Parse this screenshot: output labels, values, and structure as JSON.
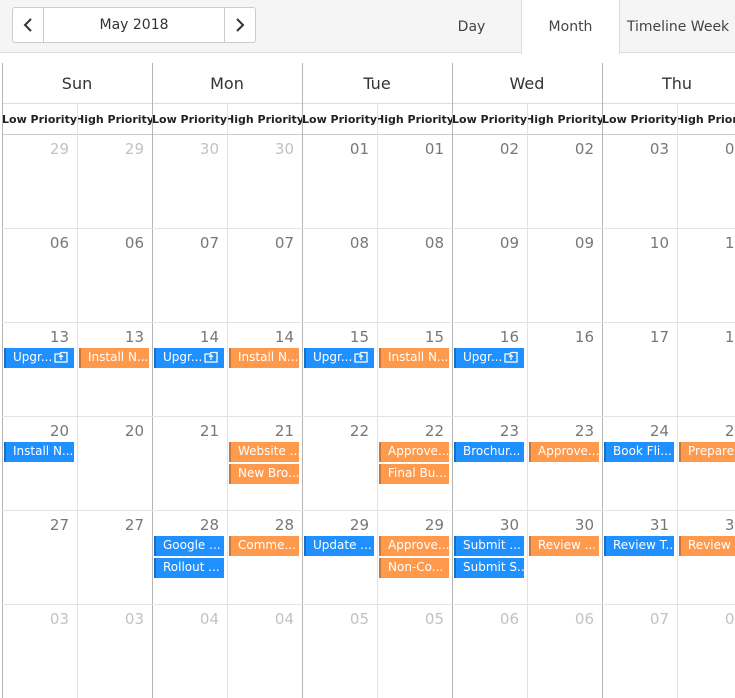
{
  "toolbar": {
    "period_title": "May 2018",
    "views": [
      "Day",
      "Month",
      "Timeline Week"
    ],
    "active_view": "Month"
  },
  "day_headers": [
    "Sun",
    "Mon",
    "Tue",
    "Wed",
    "Thu"
  ],
  "resource_headers": [
    "Low Priority",
    "High Priority"
  ],
  "weeks": [
    {
      "dates": [
        "29",
        "30",
        "01",
        "02",
        "03"
      ],
      "other_month": [
        true,
        true,
        false,
        false,
        false
      ]
    },
    {
      "dates": [
        "06",
        "07",
        "08",
        "09",
        "10"
      ],
      "other_month": [
        false,
        false,
        false,
        false,
        false
      ]
    },
    {
      "dates": [
        "13",
        "14",
        "15",
        "16",
        "17"
      ],
      "other_month": [
        false,
        false,
        false,
        false,
        false
      ]
    },
    {
      "dates": [
        "20",
        "21",
        "22",
        "23",
        "24"
      ],
      "other_month": [
        false,
        false,
        false,
        false,
        false
      ]
    },
    {
      "dates": [
        "27",
        "28",
        "29",
        "30",
        "31"
      ],
      "other_month": [
        false,
        false,
        false,
        false,
        false
      ]
    },
    {
      "dates": [
        "03",
        "04",
        "05",
        "06",
        "07"
      ],
      "other_month": [
        true,
        true,
        true,
        true,
        true
      ]
    }
  ],
  "appointments": [
    {
      "text": "Upgr...",
      "week": 2,
      "day": 0,
      "priority": "low",
      "slot": 0,
      "recurring": true
    },
    {
      "text": "Install N...",
      "week": 2,
      "day": 0,
      "priority": "high",
      "slot": 0
    },
    {
      "text": "Upgr...",
      "week": 2,
      "day": 1,
      "priority": "low",
      "slot": 0,
      "recurring": true
    },
    {
      "text": "Install N...",
      "week": 2,
      "day": 1,
      "priority": "high",
      "slot": 0
    },
    {
      "text": "Upgr...",
      "week": 2,
      "day": 2,
      "priority": "low",
      "slot": 0,
      "recurring": true
    },
    {
      "text": "Install N...",
      "week": 2,
      "day": 2,
      "priority": "high",
      "slot": 0
    },
    {
      "text": "Upgr...",
      "week": 2,
      "day": 3,
      "priority": "low",
      "slot": 0,
      "recurring": true
    },
    {
      "text": "Install N...",
      "week": 3,
      "day": 0,
      "priority": "low",
      "slot": 0
    },
    {
      "text": "Website ...",
      "week": 3,
      "day": 1,
      "priority": "high",
      "slot": 0
    },
    {
      "text": "New Bro...",
      "week": 3,
      "day": 1,
      "priority": "high",
      "slot": 1
    },
    {
      "text": "Approve...",
      "week": 3,
      "day": 2,
      "priority": "high",
      "slot": 0
    },
    {
      "text": "Final Bu...",
      "week": 3,
      "day": 2,
      "priority": "high",
      "slot": 1
    },
    {
      "text": "Brochur...",
      "week": 3,
      "day": 3,
      "priority": "low",
      "slot": 0
    },
    {
      "text": "Approve...",
      "week": 3,
      "day": 3,
      "priority": "high",
      "slot": 0
    },
    {
      "text": "Book Fli...",
      "week": 3,
      "day": 4,
      "priority": "low",
      "slot": 0
    },
    {
      "text": "Prepare ...",
      "week": 3,
      "day": 4,
      "priority": "high",
      "slot": 0
    },
    {
      "text": "Google ...",
      "week": 4,
      "day": 1,
      "priority": "low",
      "slot": 0
    },
    {
      "text": "Rollout ...",
      "week": 4,
      "day": 1,
      "priority": "low",
      "slot": 1
    },
    {
      "text": "Comme...",
      "week": 4,
      "day": 1,
      "priority": "high",
      "slot": 0
    },
    {
      "text": "Update ...",
      "week": 4,
      "day": 2,
      "priority": "low",
      "slot": 0
    },
    {
      "text": "Approve...",
      "week": 4,
      "day": 2,
      "priority": "high",
      "slot": 0
    },
    {
      "text": "Non-Co...",
      "week": 4,
      "day": 2,
      "priority": "high",
      "slot": 1
    },
    {
      "text": "Submit ...",
      "week": 4,
      "day": 3,
      "priority": "low",
      "slot": 0
    },
    {
      "text": "Submit S...",
      "week": 4,
      "day": 3,
      "priority": "low",
      "slot": 1
    },
    {
      "text": "Review ...",
      "week": 4,
      "day": 3,
      "priority": "high",
      "slot": 0
    },
    {
      "text": "Review T...",
      "week": 4,
      "day": 4,
      "priority": "low",
      "slot": 0
    },
    {
      "text": "Review ...",
      "week": 4,
      "day": 4,
      "priority": "high",
      "slot": 0
    }
  ],
  "colors": {
    "low_priority": "#1e90ff",
    "high_priority": "#ff9a4d"
  },
  "icons": {
    "prev": "chevron-left-icon",
    "next": "chevron-right-icon",
    "recurrence": "recurrence-icon"
  }
}
